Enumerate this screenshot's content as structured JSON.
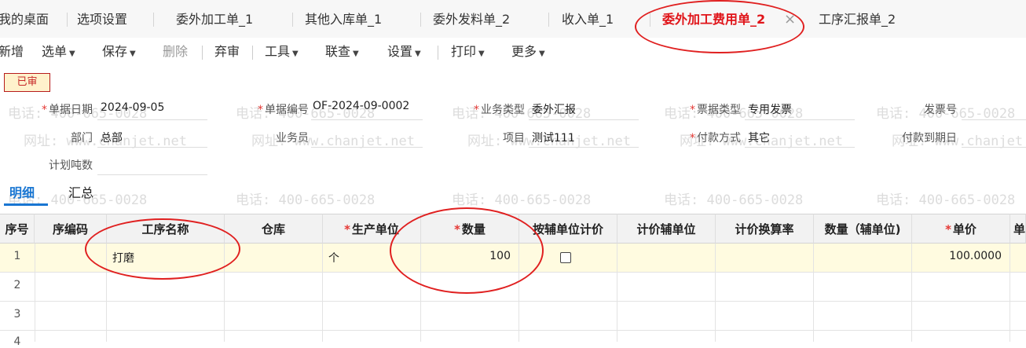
{
  "tabs": [
    {
      "label": "我的桌面"
    },
    {
      "label": "选项设置"
    },
    {
      "label": "委外加工单_1"
    },
    {
      "label": "其他入库单_1"
    },
    {
      "label": "委外发料单_2"
    },
    {
      "label": "收入单_1"
    },
    {
      "label": "委外加工费用单_2",
      "active": true
    },
    {
      "label": "工序汇报单_2"
    }
  ],
  "close_glyph": "×",
  "toolbar": {
    "new": "新增",
    "select": "选单",
    "save": "保存",
    "delete": "删除",
    "unapprove": "弃审",
    "tools": "工具",
    "query": "联查",
    "settings": "设置",
    "print": "打印",
    "more": "更多"
  },
  "status_badge": "已审",
  "form": {
    "doc_date_label": "单据日期",
    "doc_date": "2024-09-05",
    "doc_no_label": "单据编号",
    "doc_no": "OF-2024-09-0002",
    "biz_type_label": "业务类型",
    "biz_type": "委外汇报",
    "invoice_type_label": "票据类型",
    "invoice_type": "专用发票",
    "invoice_no_label": "发票号",
    "invoice_no": "",
    "dept_label": "部门",
    "dept": "总部",
    "salesman_label": "业务员",
    "salesman": "",
    "project_label": "项目",
    "project": "测试111",
    "payment_label": "付款方式",
    "payment": "其它",
    "due_date_label": "付款到期日",
    "due_date": "",
    "plan_tons_label": "计划吨数",
    "plan_tons": ""
  },
  "subtabs": {
    "detail": "明细",
    "summary": "汇总"
  },
  "grid": {
    "headers": [
      "序号",
      "序编码",
      "工序名称",
      "仓库",
      "生产单位",
      "数量",
      "按辅单位计价",
      "计价辅单位",
      "计价换算率",
      "数量（辅单位)",
      "单价",
      "单"
    ],
    "rows": [
      {
        "no": "1",
        "process": "打磨",
        "unit": "个",
        "qty": "100",
        "price": "100.0000"
      },
      {
        "no": "2"
      },
      {
        "no": "3"
      },
      {
        "no": "4"
      }
    ]
  },
  "watermark": {
    "phone": "电话: 400-665-0028",
    "site": "网址: www.chanjet.net"
  },
  "colors": {
    "active_tab": "#e0151a",
    "annotation": "#e02020",
    "highlight_row": "#fffbe0",
    "link_blue": "#1976d2"
  }
}
